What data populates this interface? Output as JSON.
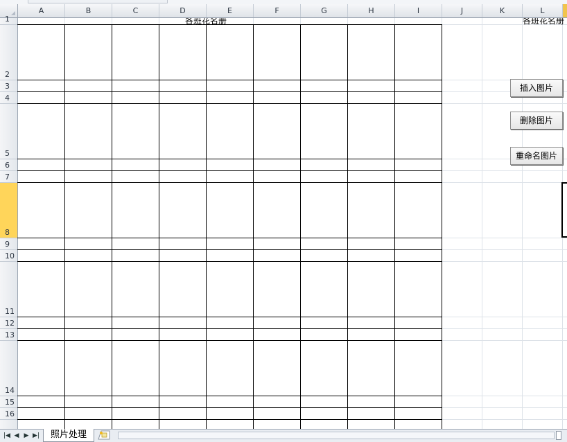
{
  "columns": [
    "A",
    "B",
    "C",
    "D",
    "E",
    "F",
    "G",
    "H",
    "I",
    "J",
    "K",
    "L"
  ],
  "rows": [
    "1",
    "2",
    "3",
    "4",
    "5",
    "6",
    "7",
    "8",
    "9",
    "10",
    "11",
    "12",
    "13",
    "14",
    "15",
    "16"
  ],
  "selected_row": "8",
  "cells": {
    "title_main": "各班花名册",
    "title_right": "各班花名册"
  },
  "buttons": {
    "insert": "插入图片",
    "delete": "删除图片",
    "rename": "重命名图片"
  },
  "sheet_tabs": [
    "照片处理"
  ],
  "nav_icons": [
    "first-sheet-icon",
    "prev-sheet-icon",
    "next-sheet-icon",
    "last-sheet-icon"
  ],
  "colors": {
    "selected_row_header": "#ffd55a",
    "border": "#000000",
    "gridline": "#dde2e8"
  }
}
